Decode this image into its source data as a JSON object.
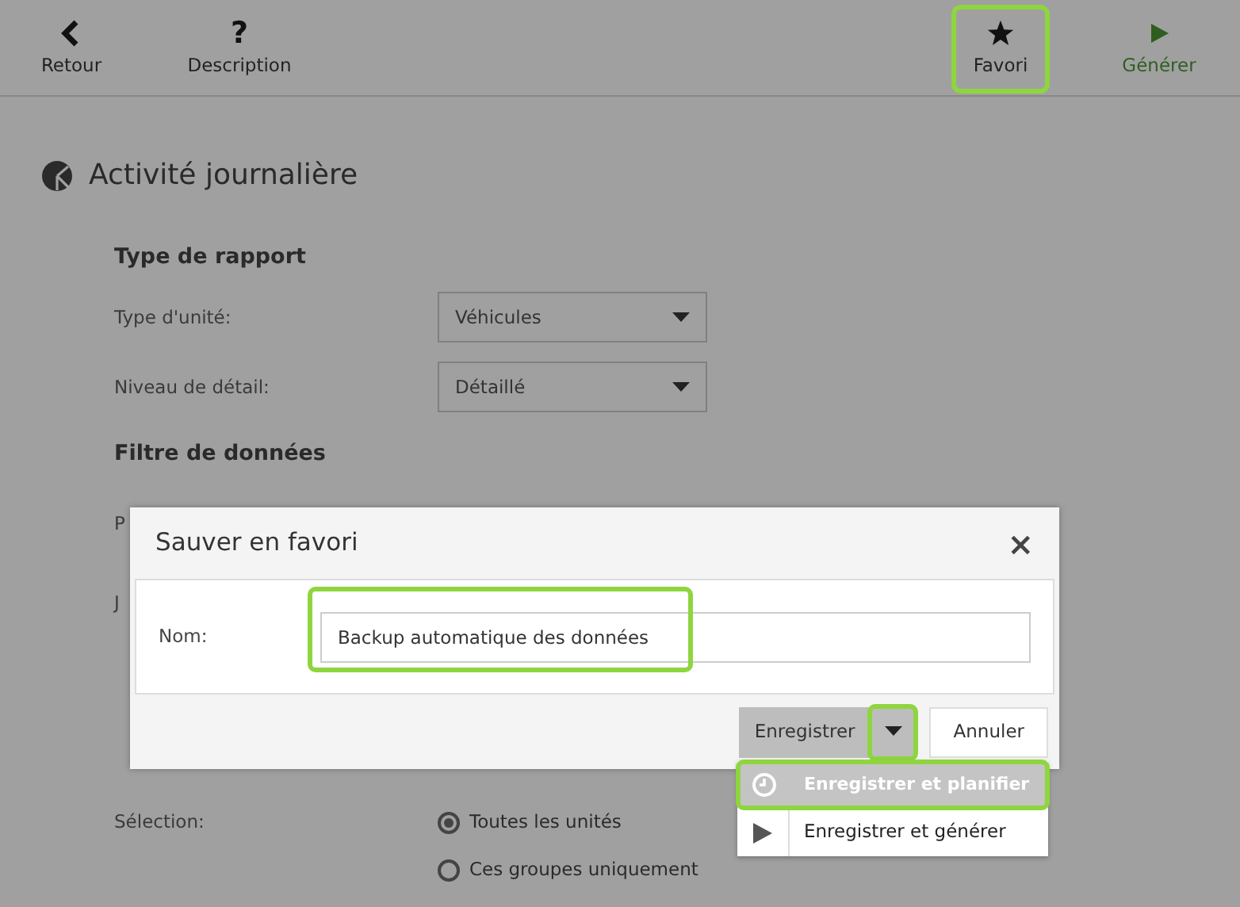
{
  "toolbar": [
    {
      "kind": "back",
      "label": "Retour",
      "highlighted": false
    },
    {
      "kind": "help",
      "icon": "?",
      "label": "Description",
      "highlighted": false
    },
    {
      "kind": "star",
      "label": "Favori",
      "highlighted": true
    },
    {
      "kind": "play",
      "label": "Générer",
      "highlighted": false
    }
  ],
  "report": {
    "title": "Activité journalière",
    "sections": [
      {
        "heading": "Type de rapport",
        "fields": [
          {
            "label": "Type d'unité:",
            "value": "Véhicules"
          },
          {
            "label": "Niveau de détail:",
            "value": "Détaillé"
          }
        ]
      },
      {
        "heading": "Filtre de données",
        "fields": [
          {
            "label": "P"
          },
          {
            "label": "J"
          }
        ]
      }
    ],
    "selection": {
      "label": "Sélection:",
      "options": [
        {
          "label": "Toutes les unités",
          "selected": true
        },
        {
          "label": "Ces groupes uniquement",
          "selected": false
        }
      ]
    }
  },
  "dialog": {
    "title": "Sauver en favori",
    "close": "×",
    "name_field": {
      "label": "Nom:",
      "value": "Backup automatique des données",
      "highlighted": true
    },
    "save_button": "Enregistrer",
    "caret_highlighted": true,
    "cancel_button": "Annuler",
    "menu": [
      {
        "kind": "clock",
        "label": "Enregistrer et planifier",
        "selected": true,
        "highlighted": true
      },
      {
        "kind": "play",
        "label": "Enregistrer et générer",
        "selected": false,
        "highlighted": false
      }
    ]
  }
}
